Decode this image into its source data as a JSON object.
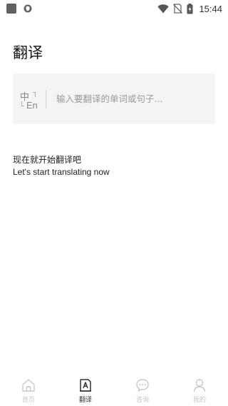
{
  "status_bar": {
    "time": "15:44",
    "icons": [
      "app-icon",
      "shield-icon",
      "wifi-icon",
      "no-sim-icon",
      "battery-charging-icon"
    ]
  },
  "page": {
    "title": "翻译"
  },
  "input_card": {
    "lang_source": "中",
    "lang_target": "En",
    "placeholder": "输入要翻译的单词或句子...",
    "value": ""
  },
  "prompt": {
    "zh": "现在就开始翻译吧",
    "en": "Let's start translating now"
  },
  "bottom_nav": {
    "items": [
      {
        "label": "首页",
        "icon": "home-icon",
        "active": false
      },
      {
        "label": "翻译",
        "icon": "translate-icon",
        "active": true
      },
      {
        "label": "咨询",
        "icon": "chat-icon",
        "active": false
      },
      {
        "label": "我的",
        "icon": "profile-icon",
        "active": false
      }
    ]
  },
  "colors": {
    "active_nav": "#333333",
    "inactive_nav": "#c4c4c4",
    "card_bg": "#f4f4f4",
    "placeholder": "#9a9a9a"
  }
}
